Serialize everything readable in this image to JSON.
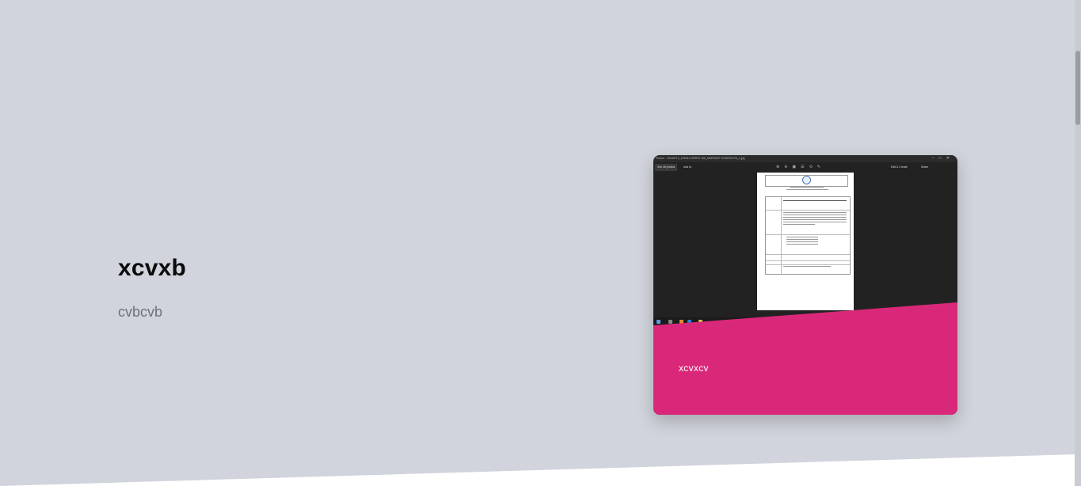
{
  "hero": {
    "title": "xcvxb",
    "subtitle": "cvbcvb"
  },
  "card": {
    "caption": "xcvxcv",
    "accent_color": "#d9287a",
    "screenshot": {
      "window_title": "Photos - 20240712_103941 SERRV NIA_MEERNET SCREEN PA_1.jpg",
      "toolbar": {
        "see_all_photos": "See all photos",
        "add_to": "Add to",
        "edit_create": "Edit & Create",
        "share": "Share"
      }
    }
  },
  "colors": {
    "background": "#d1d4dc",
    "wedge": "#ffffff",
    "title": "#0b0b0b",
    "subtitle": "#6e717a"
  }
}
